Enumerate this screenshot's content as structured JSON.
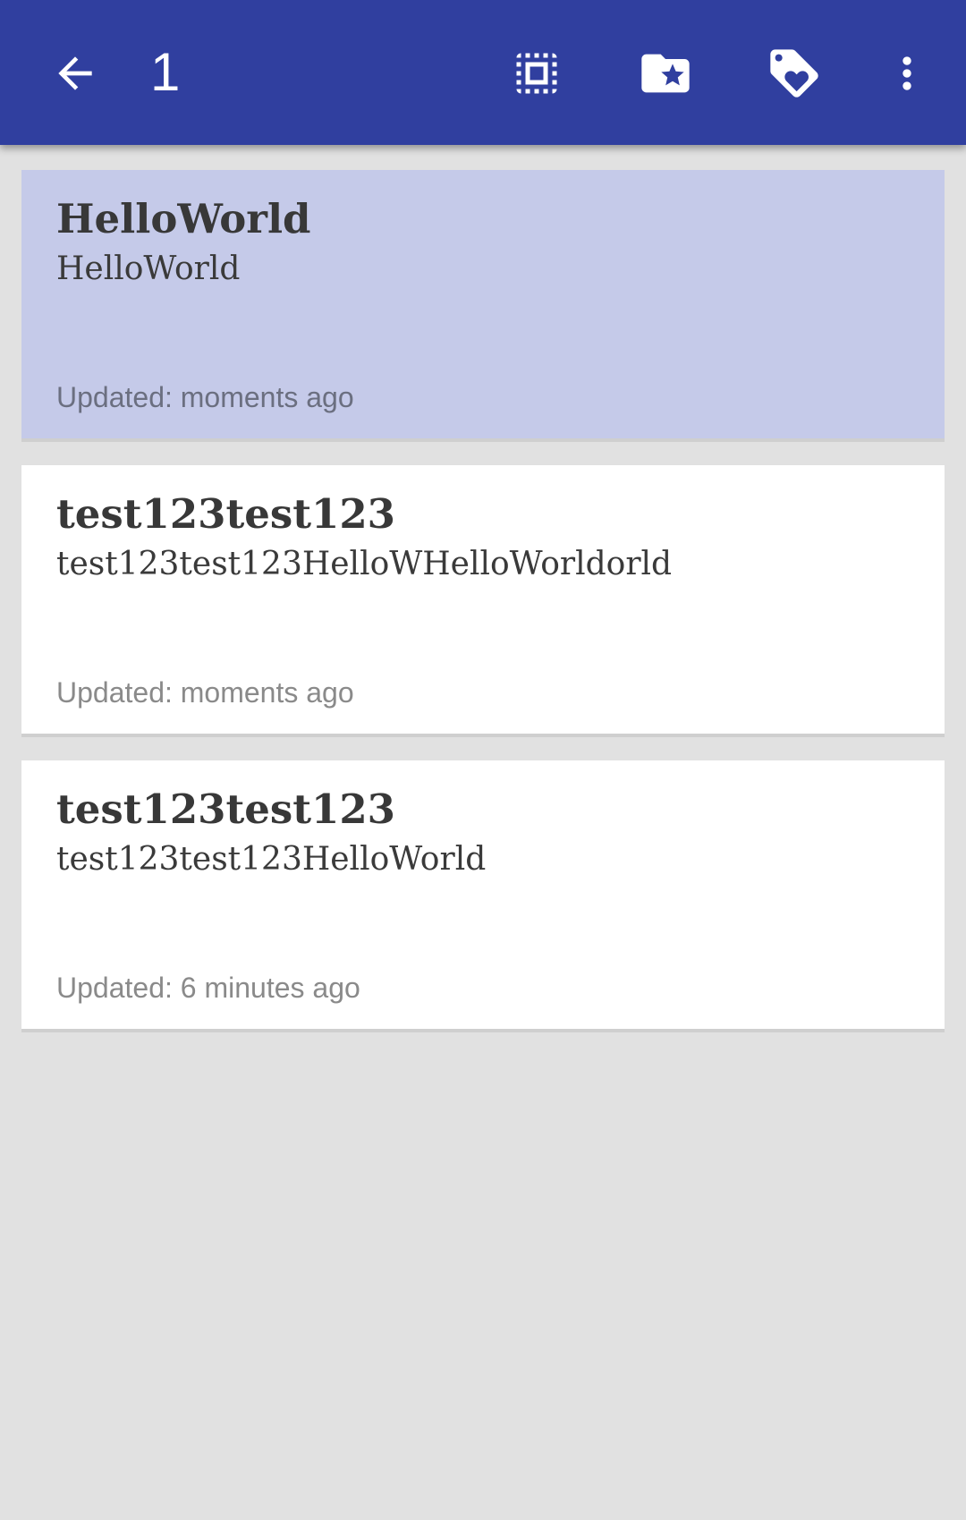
{
  "toolbar": {
    "background": "#303f9f",
    "selected_count": "1",
    "icons": {
      "back": "arrow-back-icon",
      "select_all": "select-all-icon",
      "move_to_folder": "folder-star-icon",
      "tag": "tag-heart-icon",
      "more": "more-vert-icon"
    }
  },
  "notes": [
    {
      "title": "HelloWorld",
      "body": "HelloWorld",
      "updated": "Updated: moments ago",
      "selected": true
    },
    {
      "title": "test123test123",
      "body": "test123test123HelloWHelloWorldorld",
      "updated": "Updated: moments ago",
      "selected": false
    },
    {
      "title": "test123test123",
      "body": "test123test123HelloWorld",
      "updated": "Updated: 6 minutes ago",
      "selected": false
    }
  ],
  "colors": {
    "selected_card": "#c5cae9",
    "card": "#ffffff",
    "page_background": "#e1e1e1"
  }
}
